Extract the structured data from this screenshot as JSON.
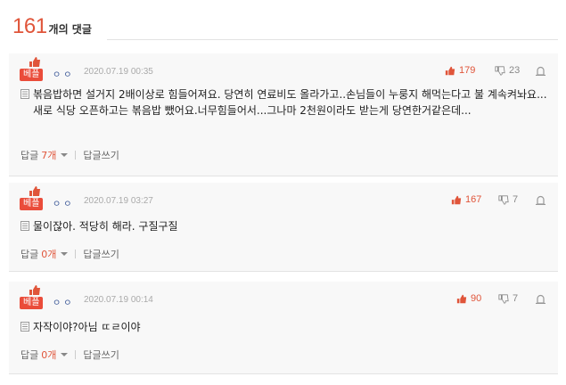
{
  "header": {
    "count": "161",
    "label": "개의 댓글"
  },
  "comments": [
    {
      "badge": "베플",
      "user": "ㅇㅇ",
      "date": "2020.07.19 00:35",
      "likes": "179",
      "dislikes": "23",
      "text": "볶음밥하면 설거지 2배이상로 힘들어져요. 당연히 연료비도 올라가고..손님들이 누룽지 해먹는다고 불 계속켜놔요...새로 식당 오픈하고는 볶음밥 뺐어요.너무힘들어서...그나마 2천원이라도 받는게 당연한거같은데...",
      "reply_label": "답글",
      "reply_count": "7개",
      "write_reply": "답글쓰기"
    },
    {
      "badge": "베플",
      "user": "ㅇㅇ",
      "date": "2020.07.19 03:27",
      "likes": "167",
      "dislikes": "7",
      "text": "물이잖아. 적당히 해라. 구질구질",
      "reply_label": "답글",
      "reply_count": "0개",
      "write_reply": "답글쓰기"
    },
    {
      "badge": "베플",
      "user": "ㅇㅇ",
      "date": "2020.07.19 00:14",
      "likes": "90",
      "dislikes": "7",
      "text": "자작이야?아님 ㄸㄹ이야",
      "reply_label": "답글",
      "reply_count": "0개",
      "write_reply": "답글쓰기"
    }
  ],
  "colors": {
    "accent": "#e0553a",
    "badge": "#ea4c3a",
    "user": "#3f5b9a",
    "panel": "#f8f8f8"
  },
  "icons": [
    "thumbs-up-icon",
    "thumbs-down-icon",
    "report-icon",
    "document-icon",
    "chevron-down-icon"
  ]
}
